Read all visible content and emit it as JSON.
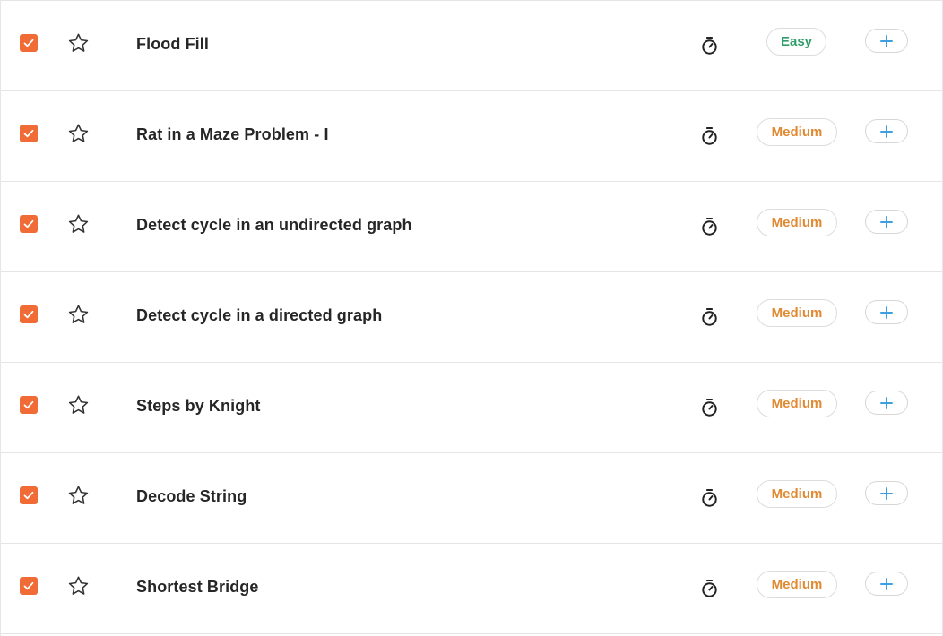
{
  "problems": [
    {
      "title": "Flood Fill",
      "difficulty": "Easy",
      "done": true
    },
    {
      "title": "Rat in a Maze Problem - I",
      "difficulty": "Medium",
      "done": true
    },
    {
      "title": "Detect cycle in an undirected graph",
      "difficulty": "Medium",
      "done": true
    },
    {
      "title": "Detect cycle in a directed graph",
      "difficulty": "Medium",
      "done": true
    },
    {
      "title": "Steps by Knight",
      "difficulty": "Medium",
      "done": true
    },
    {
      "title": "Decode String",
      "difficulty": "Medium",
      "done": true
    },
    {
      "title": "Shortest Bridge",
      "difficulty": "Medium",
      "done": true
    }
  ],
  "icons": {
    "checkbox": "checkmark-icon",
    "bookmark": "star-icon",
    "timer": "stopwatch-icon",
    "add": "plus-icon"
  },
  "colors": {
    "checkbox": "#f06b35",
    "easy": "#2f9e6a",
    "medium": "#e08a33",
    "add": "#3d9fe0"
  }
}
